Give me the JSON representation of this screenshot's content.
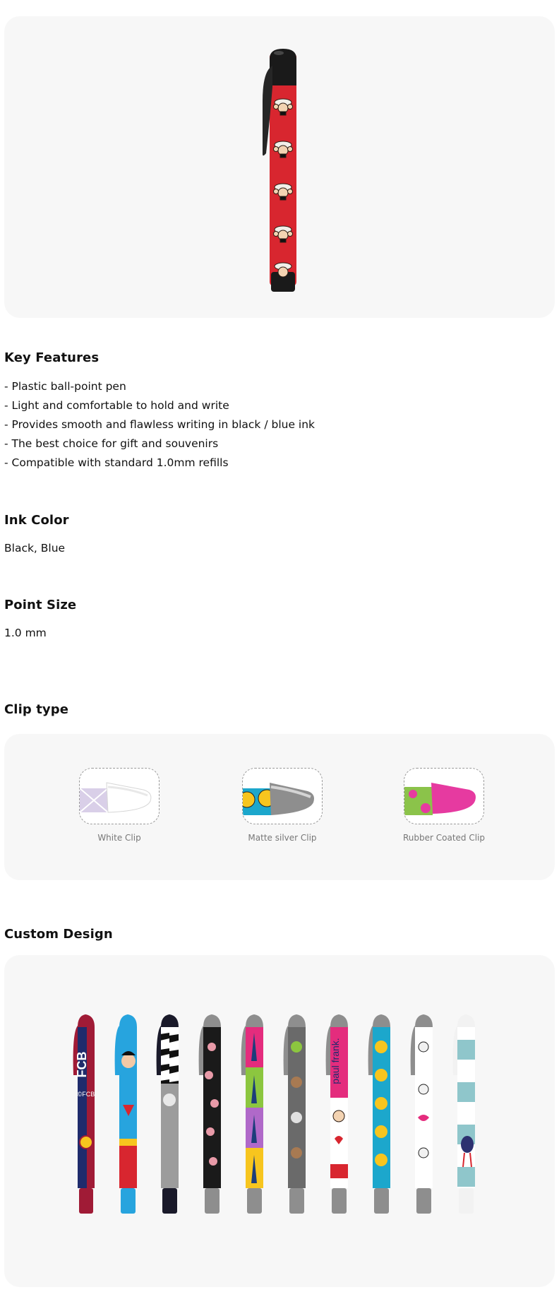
{
  "sections": {
    "key_features": {
      "title": "Key Features",
      "items": [
        "- Plastic ball-point pen",
        "- Light and comfortable to hold and write",
        "- Provides smooth and flawless writing in black / blue ink",
        "- The best choice for gift and souvenirs",
        "- Compatible with standard 1.0mm refills"
      ]
    },
    "ink_color": {
      "title": "Ink Color",
      "value": "Black, Blue"
    },
    "point_size": {
      "title": "Point Size",
      "value": "1.0 mm"
    },
    "clip_type": {
      "title": "Clip type",
      "options": [
        {
          "label": "White Clip",
          "icon": "white-clip-icon"
        },
        {
          "label": "Matte silver Clip",
          "icon": "matte-silver-clip-icon"
        },
        {
          "label": "Rubber Coated Clip",
          "icon": "rubber-coated-clip-icon"
        }
      ]
    },
    "custom_design": {
      "title": "Custom Design",
      "pen_text": {
        "fcb": "FCB",
        "fcb_small": "©FCB",
        "paul_frank": "paul frank."
      }
    }
  },
  "colors": {
    "panel_bg": "#f7f7f7",
    "hero_pen_body": "#d8262f",
    "pen_cap_black": "#1a1a1a",
    "fcb_red": "#a01b36",
    "fcb_blue": "#1f2b6c",
    "superman_blue": "#27a4de",
    "smiley_cyan": "#1ca7cc",
    "smiley_yellow": "#f7c51e",
    "paul_frank_pink": "#e42c7d",
    "rubber_pink": "#e63aa0",
    "rubber_green": "#8bc34a",
    "stripe_teal": "#8fc6cb",
    "owl_grey": "#6a6a6a"
  }
}
